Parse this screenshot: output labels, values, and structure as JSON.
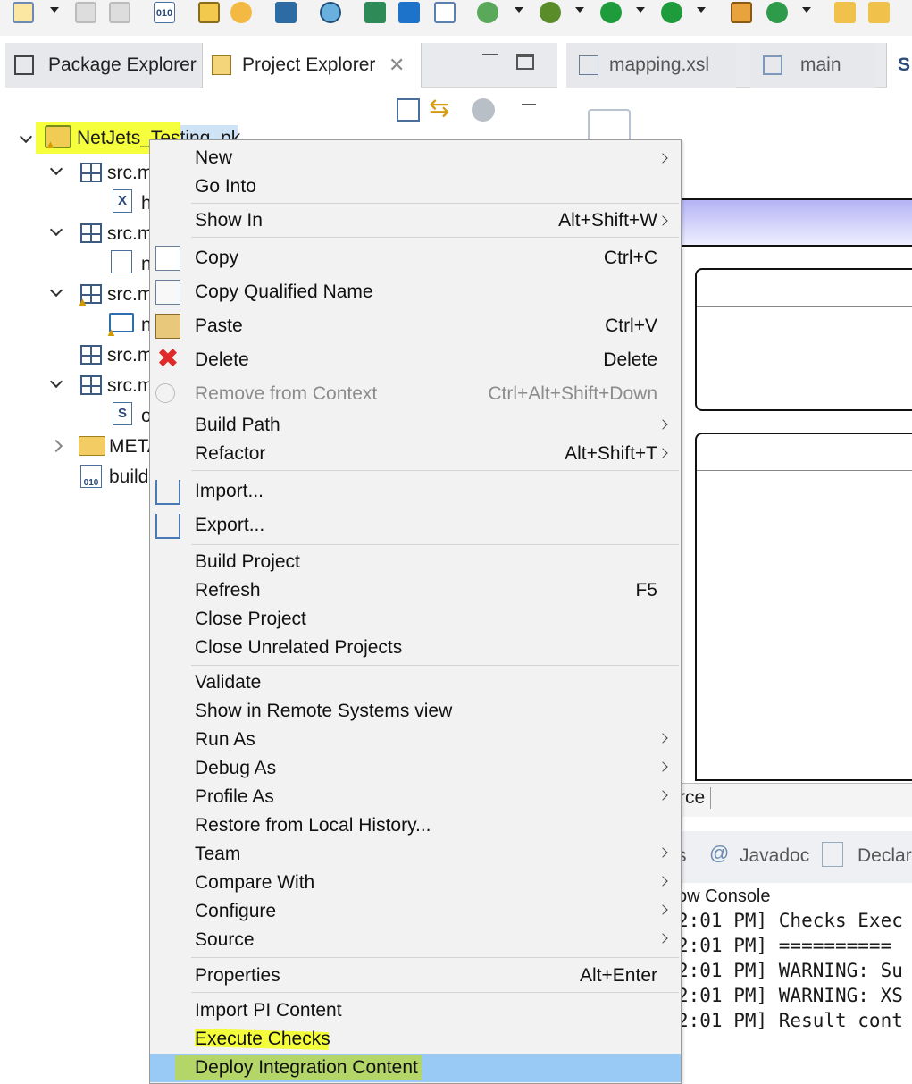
{
  "colors": {
    "highlight_yellow": "#f4ff1a",
    "selection_blue": "#99c9f5",
    "menu_bg": "#f2f2f2"
  },
  "toolbar": {
    "icons": [
      "new-wizard-icon",
      "save-icon",
      "save-all-icon",
      "binary-file-icon",
      "build-icon",
      "transfer-icon",
      "monitor-icon",
      "pin-icon",
      "deploy-icon",
      "run-config-icon",
      "checklist-icon",
      "run-step-icon",
      "debug-bug-icon",
      "run-icon",
      "run-external-icon",
      "package-icon",
      "refresh-icon",
      "open-folder-icon",
      "folder-icon"
    ]
  },
  "left_view": {
    "tabs": [
      {
        "label": "Package Explorer",
        "icon": "package-explorer-icon"
      },
      {
        "label": "Project Explorer",
        "icon": "project-explorer-icon"
      }
    ],
    "tree": {
      "project": "NetJets_Testing_pk",
      "items": [
        {
          "label": "src.m",
          "icon": "package-icon"
        },
        {
          "label": "h",
          "icon": "xml-file-icon"
        },
        {
          "label": "src.m",
          "icon": "package-icon"
        },
        {
          "label": "n",
          "icon": "xsl-file-icon"
        },
        {
          "label": "src.m",
          "icon": "package-warning-icon"
        },
        {
          "label": "n",
          "icon": "mapping-icon"
        },
        {
          "label": "src.m",
          "icon": "package-icon"
        },
        {
          "label": "src.m",
          "icon": "package-icon"
        },
        {
          "label": "o",
          "icon": "source-file-icon"
        },
        {
          "label": "METAINF",
          "icon": "folder-icon"
        },
        {
          "label": "build",
          "icon": "binary-file-icon"
        }
      ]
    }
  },
  "editor": {
    "tabs": [
      {
        "label": "mapping.xsl",
        "icon": "xsl-file-icon"
      },
      {
        "label": "main",
        "icon": "flow-icon"
      },
      {
        "label": "S",
        "icon": "source-tab-icon"
      }
    ],
    "bottom_tab_fragment": "rce",
    "bottom_views": [
      {
        "label": "s",
        "icon": ""
      },
      {
        "label": "Javadoc",
        "icon": "at-icon"
      },
      {
        "label": "Declara",
        "icon": "declaration-icon"
      }
    ],
    "console_title": "ow Console",
    "console_lines": [
      "2:01 PM] Checks Exec",
      "2:01 PM] ==========",
      "2:01 PM] WARNING: Su",
      "2:01 PM] WARNING: XS",
      "2:01 PM] Result cont"
    ]
  },
  "context_menu": {
    "items": [
      {
        "label": "New",
        "shortcut": "",
        "submenu": true
      },
      {
        "label": "Go Into",
        "shortcut": "",
        "submenu": false
      },
      {
        "label": "Show In",
        "shortcut": "Alt+Shift+W",
        "submenu": true
      },
      {
        "label": "Copy",
        "shortcut": "Ctrl+C",
        "submenu": false,
        "icon": "copy-icon"
      },
      {
        "label": "Copy Qualified Name",
        "shortcut": "",
        "submenu": false,
        "icon": "copy-qualified-icon"
      },
      {
        "label": "Paste",
        "shortcut": "Ctrl+V",
        "submenu": false,
        "icon": "paste-icon"
      },
      {
        "label": "Delete",
        "shortcut": "Delete",
        "submenu": false,
        "icon": "delete-icon"
      },
      {
        "label": "Remove from Context",
        "shortcut": "Ctrl+Alt+Shift+Down",
        "submenu": false,
        "disabled": true,
        "icon": "remove-context-icon"
      },
      {
        "label": "Build Path",
        "shortcut": "",
        "submenu": true
      },
      {
        "label": "Refactor",
        "shortcut": "Alt+Shift+T",
        "submenu": true
      },
      {
        "label": "Import...",
        "shortcut": "",
        "submenu": false,
        "icon": "import-icon"
      },
      {
        "label": "Export...",
        "shortcut": "",
        "submenu": false,
        "icon": "export-icon"
      },
      {
        "label": "Build Project",
        "shortcut": "",
        "submenu": false
      },
      {
        "label": "Refresh",
        "shortcut": "F5",
        "submenu": false
      },
      {
        "label": "Close Project",
        "shortcut": "",
        "submenu": false
      },
      {
        "label": "Close Unrelated Projects",
        "shortcut": "",
        "submenu": false
      },
      {
        "label": "Validate",
        "shortcut": "",
        "submenu": false
      },
      {
        "label": "Show in Remote Systems view",
        "shortcut": "",
        "submenu": false
      },
      {
        "label": "Run As",
        "shortcut": "",
        "submenu": true
      },
      {
        "label": "Debug As",
        "shortcut": "",
        "submenu": true
      },
      {
        "label": "Profile As",
        "shortcut": "",
        "submenu": true
      },
      {
        "label": "Restore from Local History...",
        "shortcut": "",
        "submenu": false
      },
      {
        "label": "Team",
        "shortcut": "",
        "submenu": true
      },
      {
        "label": "Compare With",
        "shortcut": "",
        "submenu": true
      },
      {
        "label": "Configure",
        "shortcut": "",
        "submenu": true
      },
      {
        "label": "Source",
        "shortcut": "",
        "submenu": true
      },
      {
        "label": "Properties",
        "shortcut": "Alt+Enter",
        "submenu": false
      },
      {
        "label": "Import PI Content",
        "shortcut": "",
        "submenu": false
      },
      {
        "label": "Execute Checks",
        "shortcut": "",
        "submenu": false
      },
      {
        "label": "Deploy Integration Content",
        "shortcut": "",
        "submenu": false,
        "selected": true
      }
    ]
  }
}
